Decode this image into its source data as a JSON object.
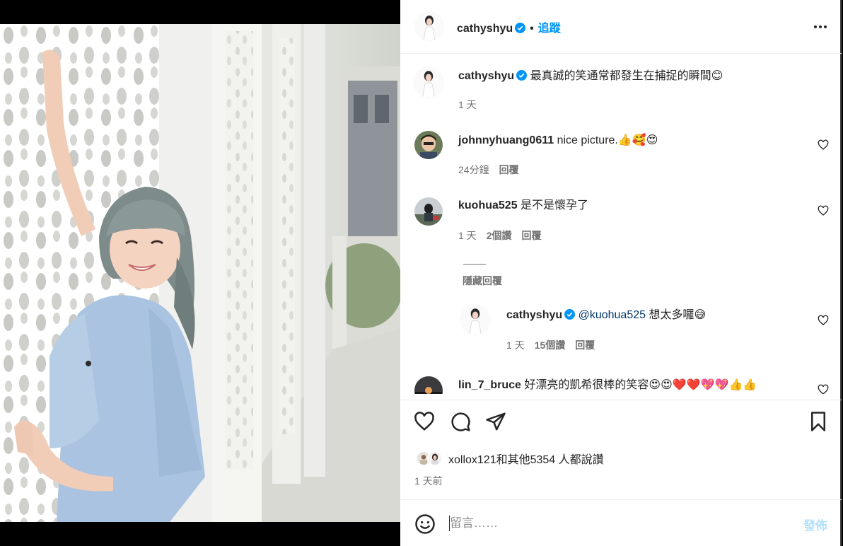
{
  "post": {
    "username": "cathyshyu",
    "dot": "•",
    "follow_label": "追蹤",
    "caption": "最真誠的笑通常都發生在捕捉的瞬間",
    "caption_emoji": "😊",
    "caption_age": "1 天"
  },
  "comments": [
    {
      "username": "johnnyhuang0611",
      "text": "nice picture.",
      "emoji": "👍🥰😍",
      "age": "24分鐘",
      "reply_label": "回覆"
    },
    {
      "username": "kuohua525",
      "text": "是不是懷孕了",
      "age": "1 天",
      "likes": "2個讚",
      "reply_label": "回覆",
      "hide_replies": "隱藏回覆"
    },
    {
      "username": "lin_7_bruce",
      "text": "好漂亮的凱希很棒的笑容",
      "emoji": "😍😍❤️❤️💖💖👍👍"
    }
  ],
  "reply": {
    "username": "cathyshyu",
    "mention": "@kuohua525",
    "text": "想太多囉",
    "emoji": "😅",
    "age": "1 天",
    "likes": "15個讚",
    "reply_label": "回覆"
  },
  "likes_summary": "xollox121和其他5354 人都說讚",
  "time_ago": "1 天前",
  "comment_box": {
    "placeholder": "留言……",
    "post_label": "發佈"
  },
  "colors": {
    "link_blue": "#0095f6",
    "verified_blue": "#0095f6",
    "dress": "#a9c3e0"
  }
}
